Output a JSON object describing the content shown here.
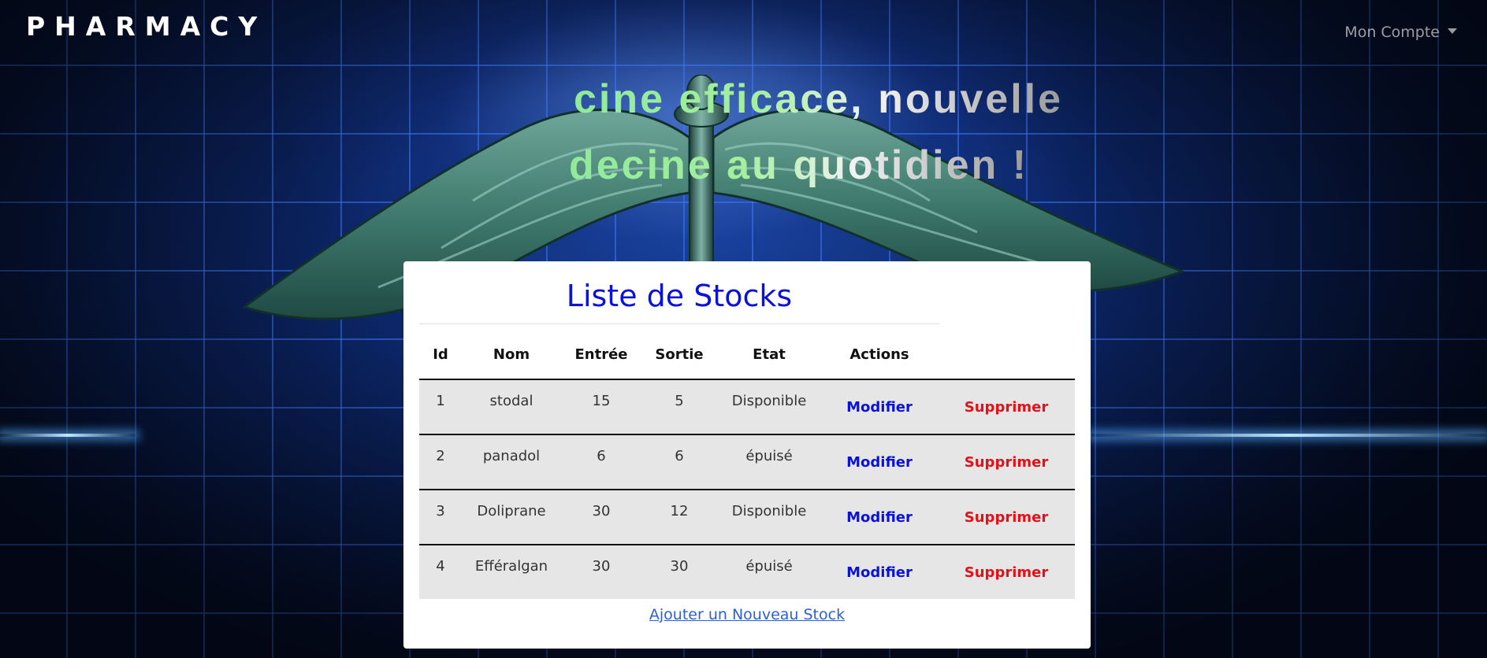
{
  "navbar": {
    "brand": "PHARMACY",
    "account_label": "Mon Compte"
  },
  "hero": {
    "line1": "cine efficace, nouvelle",
    "line2": "decine au quotidien !"
  },
  "stocks": {
    "title": "Liste de Stocks",
    "columns": [
      "Id",
      "Nom",
      "Entrée",
      "Sortie",
      "Etat",
      "Actions"
    ],
    "rows": [
      {
        "id": "1",
        "nom": "stodal",
        "entree": "15",
        "sortie": "5",
        "etat": "Disponible",
        "modifier": "Modifier",
        "supprimer": "Supprimer"
      },
      {
        "id": "2",
        "nom": "panadol",
        "entree": "6",
        "sortie": "6",
        "etat": "épuisé",
        "modifier": "Modifier",
        "supprimer": "Supprimer"
      },
      {
        "id": "3",
        "nom": "Doliprane",
        "entree": "30",
        "sortie": "12",
        "etat": "Disponible",
        "modifier": "Modifier",
        "supprimer": "Supprimer"
      },
      {
        "id": "4",
        "nom": "Efféralgan",
        "entree": "30",
        "sortie": "30",
        "etat": "épuisé",
        "modifier": "Modifier",
        "supprimer": "Supprimer"
      }
    ],
    "add_link": "Ajouter un Nouveau Stock"
  },
  "colors": {
    "title_blue": "#0b12d8",
    "delete_red": "#e1121a",
    "link_blue": "#2b61d6",
    "row_gray": "#e6e6e6"
  },
  "icons": [
    "caduceus-illustration",
    "dropdown-caret-icon"
  ]
}
